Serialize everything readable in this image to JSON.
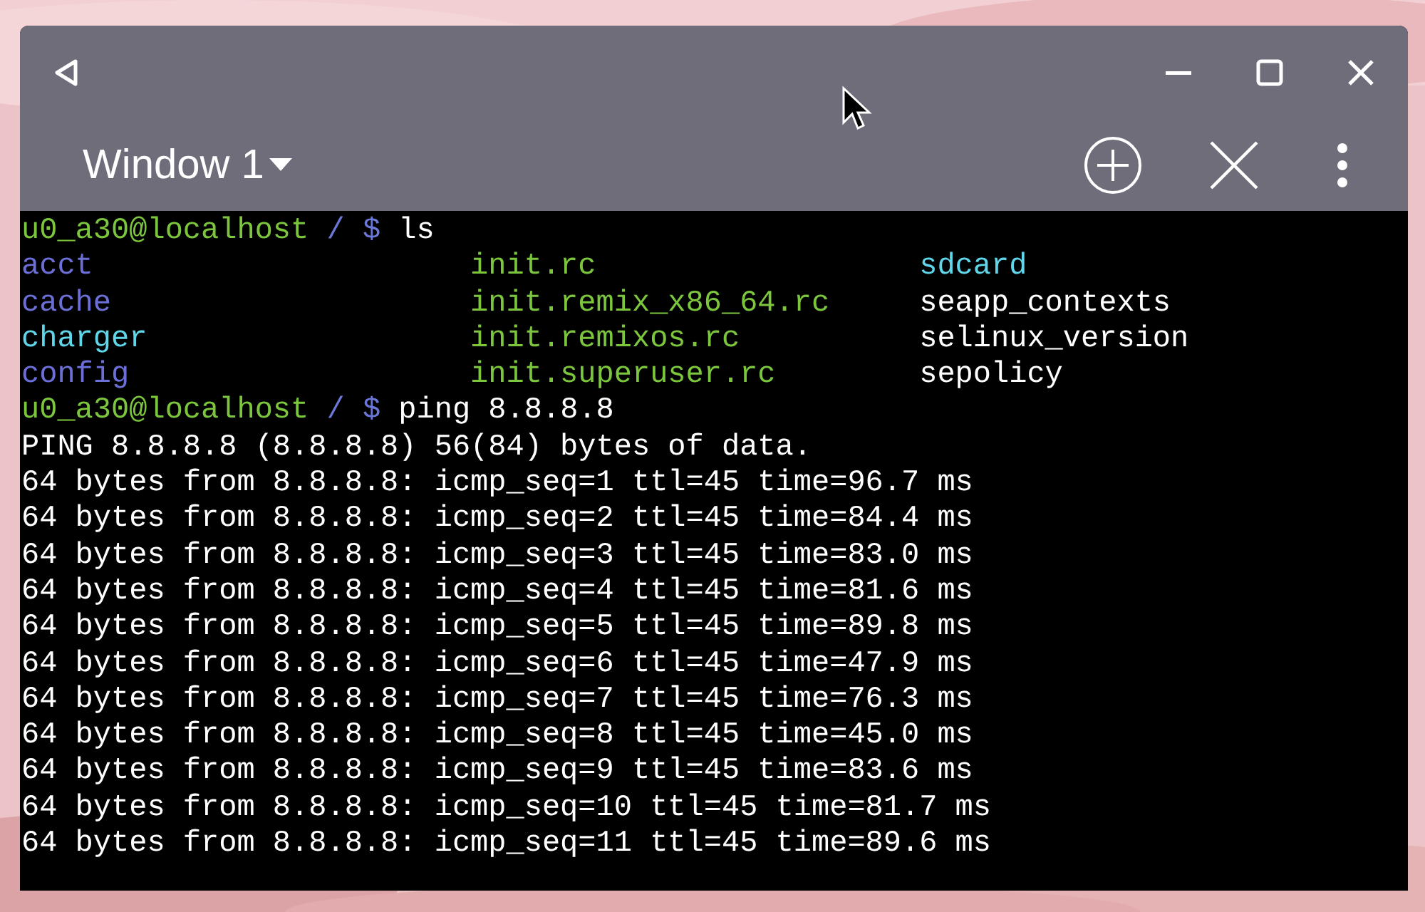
{
  "window": {
    "session_tab": {
      "label": "Window 1"
    }
  },
  "terminal": {
    "lines": [
      {
        "kind": "prompt",
        "user_host": "u0_a30@localhost",
        "path": "/ $",
        "command": "ls"
      },
      {
        "kind": "listing",
        "entries": [
          {
            "name": "acct",
            "color": "#6b6fd6"
          },
          {
            "name": "init.rc",
            "color": "#7cc63e"
          },
          {
            "name": "sdcard",
            "color": "#5fd6ea"
          }
        ]
      },
      {
        "kind": "listing",
        "entries": [
          {
            "name": "cache",
            "color": "#6b6fd6"
          },
          {
            "name": "init.remix_x86_64.rc",
            "color": "#7cc63e"
          },
          {
            "name": "seapp_contexts",
            "color": "#ffffff"
          }
        ]
      },
      {
        "kind": "listing",
        "entries": [
          {
            "name": "charger",
            "color": "#5fd6ea"
          },
          {
            "name": "init.remixos.rc",
            "color": "#7cc63e"
          },
          {
            "name": "selinux_version",
            "color": "#ffffff"
          }
        ]
      },
      {
        "kind": "listing",
        "entries": [
          {
            "name": "config",
            "color": "#6b6fd6"
          },
          {
            "name": "init.superuser.rc",
            "color": "#7cc63e"
          },
          {
            "name": "sepolicy",
            "color": "#ffffff"
          }
        ]
      },
      {
        "kind": "prompt",
        "user_host": "u0_a30@localhost",
        "path": "/ $",
        "command": "ping 8.8.8.8"
      },
      {
        "kind": "output",
        "text": "PING 8.8.8.8 (8.8.8.8) 56(84) bytes of data."
      },
      {
        "kind": "output",
        "text": "64 bytes from 8.8.8.8: icmp_seq=1 ttl=45 time=96.7 ms"
      },
      {
        "kind": "output",
        "text": "64 bytes from 8.8.8.8: icmp_seq=2 ttl=45 time=84.4 ms"
      },
      {
        "kind": "output",
        "text": "64 bytes from 8.8.8.8: icmp_seq=3 ttl=45 time=83.0 ms"
      },
      {
        "kind": "output",
        "text": "64 bytes from 8.8.8.8: icmp_seq=4 ttl=45 time=81.6 ms"
      },
      {
        "kind": "output",
        "text": "64 bytes from 8.8.8.8: icmp_seq=5 ttl=45 time=89.8 ms"
      },
      {
        "kind": "output",
        "text": "64 bytes from 8.8.8.8: icmp_seq=6 ttl=45 time=47.9 ms"
      },
      {
        "kind": "output",
        "text": "64 bytes from 8.8.8.8: icmp_seq=7 ttl=45 time=76.3 ms"
      },
      {
        "kind": "output",
        "text": "64 bytes from 8.8.8.8: icmp_seq=8 ttl=45 time=45.0 ms"
      },
      {
        "kind": "output",
        "text": "64 bytes from 8.8.8.8: icmp_seq=9 ttl=45 time=83.6 ms"
      },
      {
        "kind": "output",
        "text": "64 bytes from 8.8.8.8: icmp_seq=10 ttl=45 time=81.7 ms"
      },
      {
        "kind": "output",
        "text": "64 bytes from 8.8.8.8: icmp_seq=11 ttl=45 time=89.6 ms"
      }
    ]
  }
}
